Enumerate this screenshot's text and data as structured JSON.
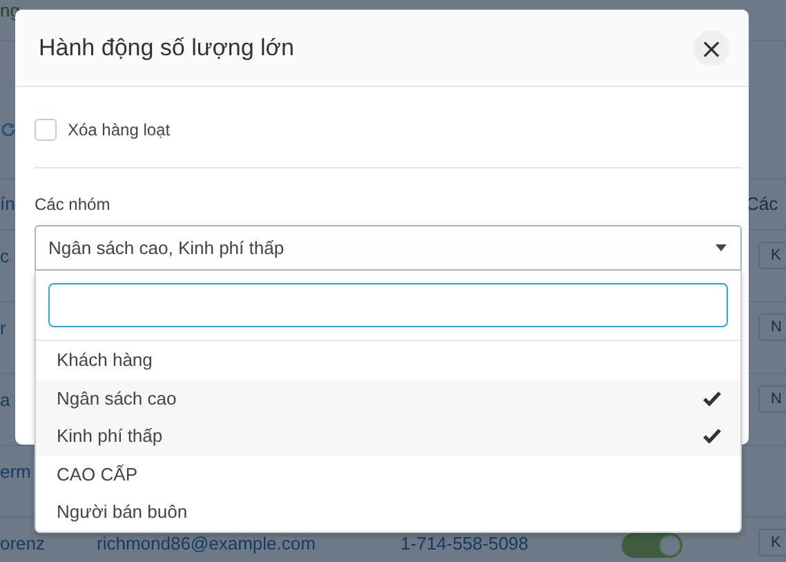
{
  "background_table": {
    "rows": [
      {
        "kind": "top",
        "cells": [
          "ng"
        ]
      },
      {
        "kind": "toolbar",
        "cells": []
      },
      {
        "kind": "header",
        "cells": [
          "ín"
        ],
        "right_text": "Các"
      },
      {
        "kind": "data",
        "cells": [
          "c"
        ],
        "button": "K"
      },
      {
        "kind": "data",
        "cells": [
          "r"
        ],
        "button": "N"
      },
      {
        "kind": "data",
        "cells": [
          "a"
        ],
        "button": "N"
      },
      {
        "kind": "data",
        "cells": [
          "erm"
        ]
      },
      {
        "kind": "data",
        "cells": [
          "orenz",
          "richmond86@example.com",
          "1-714-558-5098"
        ],
        "toggle": {
          "on": true
        },
        "button": "K"
      }
    ]
  },
  "dialog": {
    "title": "Hành động số lượng lớn",
    "close": "×",
    "bulk_delete": {
      "label": "Xóa hàng loạt",
      "checked": false
    },
    "groups": {
      "label": "Các nhóm",
      "value": "Ngân sách cao, Kinh phí thấp",
      "expanded": true,
      "options": [
        {
          "label": "Khách hàng",
          "selected": false
        },
        {
          "label": "Ngân sách cao",
          "selected": true
        },
        {
          "label": "Kinh phí thấp",
          "selected": true
        },
        {
          "label": "CAO CẤP",
          "selected": false
        },
        {
          "label": "Người bán buôn",
          "selected": false
        }
      ]
    }
  }
}
